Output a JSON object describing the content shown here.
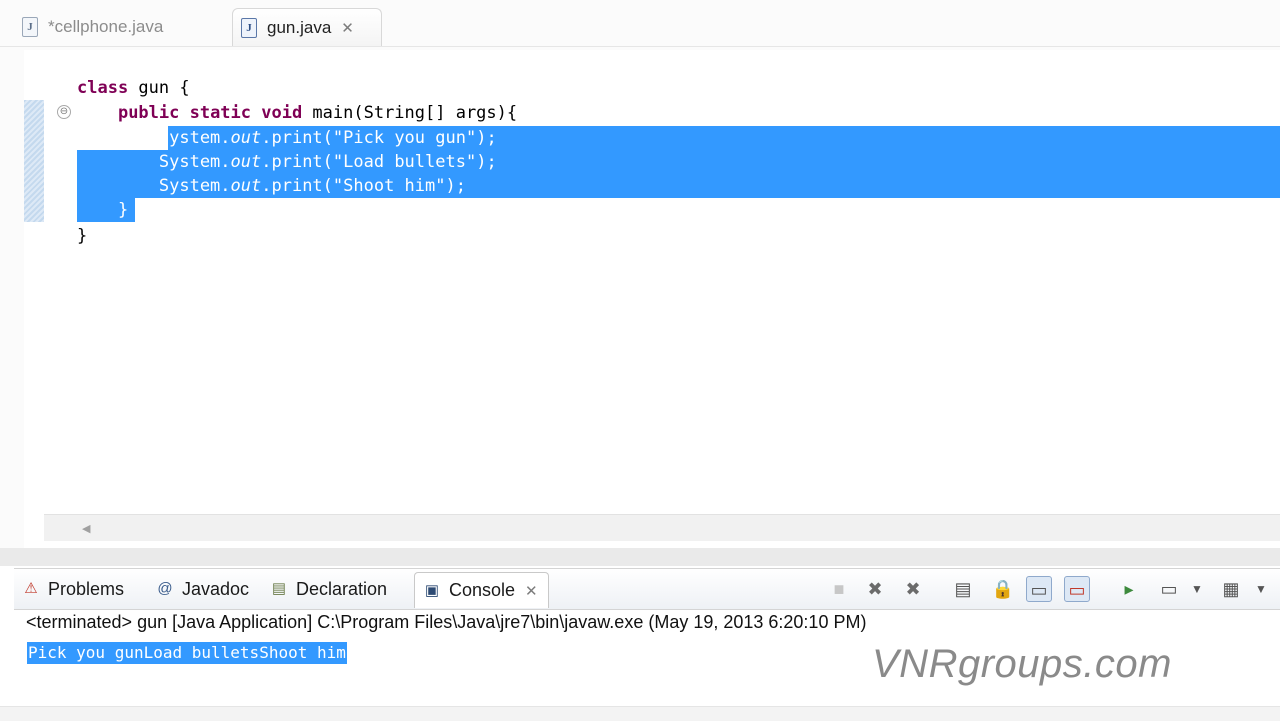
{
  "editor_tabs": [
    {
      "label": "*cellphone.java",
      "icon": "java-file-icon",
      "active": false
    },
    {
      "label": "gun.java",
      "icon": "java-file-icon",
      "active": true
    }
  ],
  "editor": {
    "lines": [
      {
        "kw": "class",
        "rest": " gun {"
      },
      {
        "indent": "    ",
        "kw": "public static void",
        "rest": " main(String[] args){"
      },
      {
        "pre": "        System.",
        "it": "out",
        "mid": ".print(",
        "str": "\"Pick you gun\"",
        "post": ");"
      },
      {
        "pre": "        System.",
        "it": "out",
        "mid": ".print(",
        "str": "\"Load bullets\"",
        "post": ");"
      },
      {
        "pre": "        System.",
        "it": "out",
        "mid": ".print(",
        "str": "\"Shoot him\"",
        "post": ");"
      },
      {
        "text": "    }"
      },
      {
        "text": "}"
      }
    ],
    "fold_glyph": "⊖"
  },
  "view_tabs": [
    {
      "label": "Problems",
      "icon": "problems-icon"
    },
    {
      "label": "Javadoc",
      "icon": "javadoc-at-icon"
    },
    {
      "label": "Declaration",
      "icon": "declaration-icon"
    },
    {
      "label": "Console",
      "icon": "console-icon",
      "active": true
    }
  ],
  "console": {
    "header": "<terminated> gun [Java Application] C:\\Program Files\\Java\\jre7\\bin\\javaw.exe (May 19, 2013 6:20:10 PM)",
    "output": "Pick you gunLoad bulletsShoot him"
  },
  "watermark": "VNRgroups.com",
  "colors": {
    "selection": "#3399ff",
    "keyword": "#7f0055",
    "string": "#2a00ff"
  }
}
